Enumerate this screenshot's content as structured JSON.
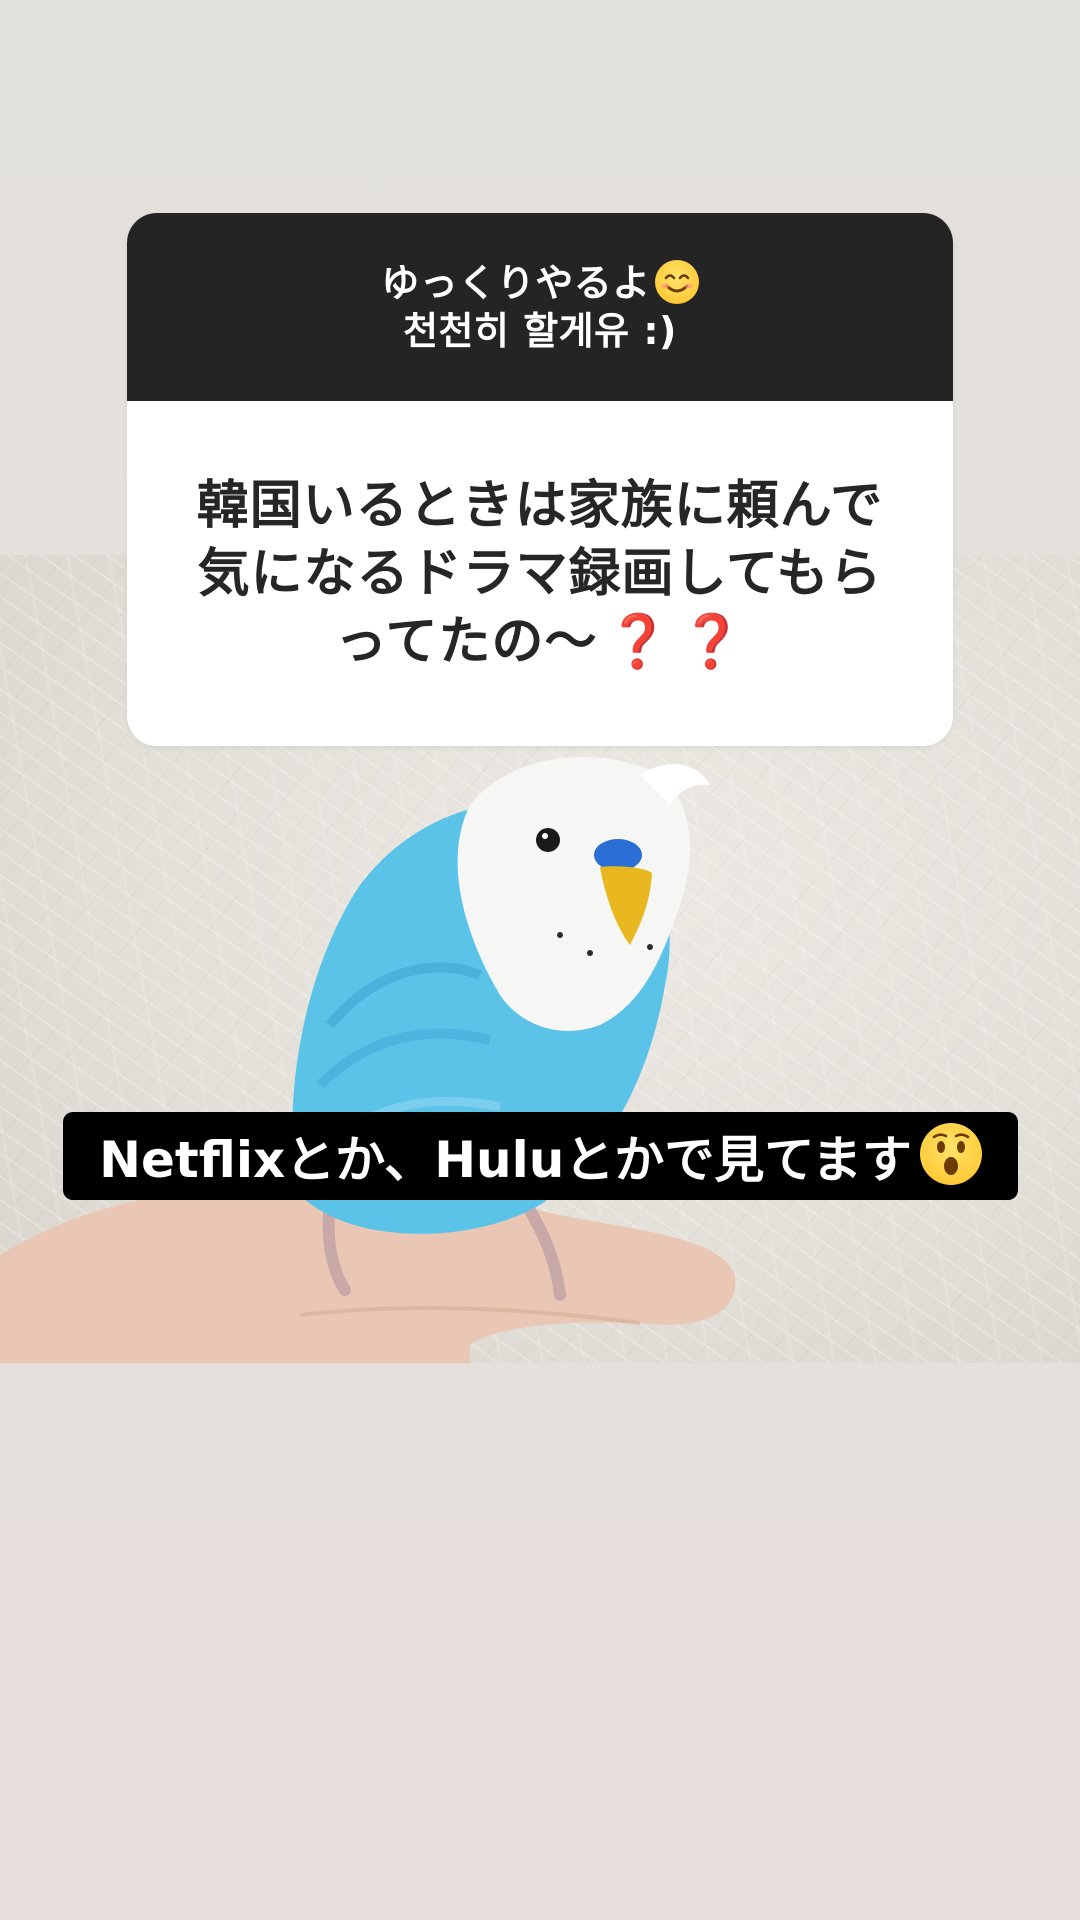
{
  "photo": {
    "subject": "budgerigar-on-finger",
    "colors": {
      "wall": "#e3dfd9",
      "bird_body": "#5cc3e8",
      "bird_face": "#f6f6f4",
      "beak": "#e9b820",
      "cere": "#2b6fd6",
      "hand": "#e9c7b4"
    }
  },
  "question": {
    "header_line1": "ゆっくりやるよ",
    "header_emoji": "smiling-face-emoji",
    "header_line2": "천천히 할게유 :)",
    "text_line1": "韓国いるときは家族に頼んで",
    "text_line2": "気になるドラマ録画してもら",
    "text_line3": "ってたの〜",
    "marks": [
      "❓",
      "❓"
    ],
    "mark_color": "#d0161b"
  },
  "answer": {
    "text": "Netflixとか、Huluとかで見てます",
    "emoji": "astonished-face-emoji"
  }
}
